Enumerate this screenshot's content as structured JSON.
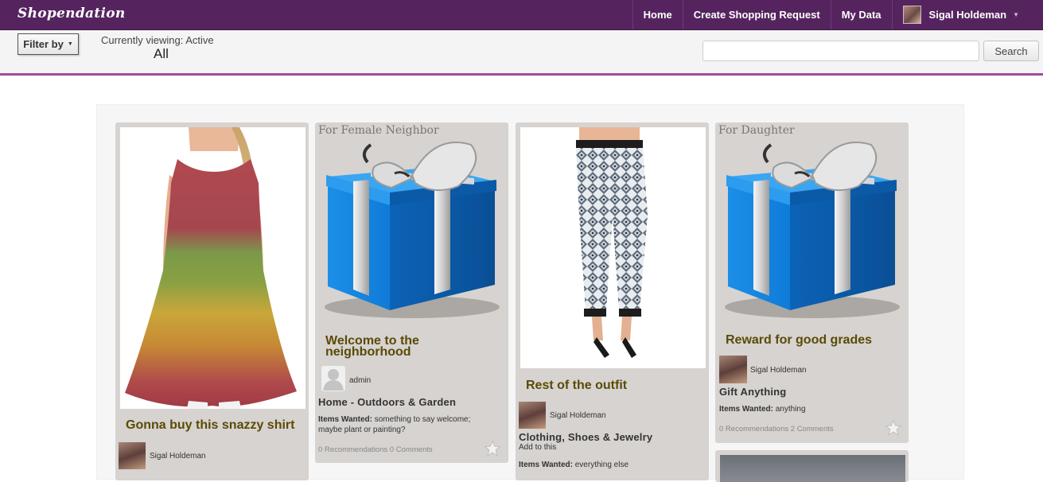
{
  "app": {
    "brand": "Shopendation"
  },
  "nav": {
    "home": "Home",
    "create": "Create Shopping Request",
    "mydata": "My Data",
    "user": "Sigal Holdeman"
  },
  "filter": {
    "button": "Filter by",
    "viewing_label": "Currently viewing: Active",
    "viewing_value": "All"
  },
  "search": {
    "placeholder": "",
    "button": "Search"
  },
  "cards": [
    {
      "title": "Gonna buy this snazzy shirt",
      "user": "Sigal Holdeman"
    },
    {
      "for": "For Female Neighbor",
      "title": "Welcome to the neighborhood",
      "user": "admin",
      "category": "Home - Outdoors & Garden",
      "wanted_label": "Items Wanted:",
      "wanted": "something to say welcome; maybe plant or painting?",
      "meta": "0 Recommendations 0 Comments"
    },
    {
      "title": "Rest of the outfit",
      "user": "Sigal Holdeman",
      "category": "Clothing, Shoes & Jewelry",
      "subnote": "Add to this",
      "wanted_label": "Items Wanted:",
      "wanted": "everything else"
    },
    {
      "for": "For Daughter",
      "title": "Reward for good grades",
      "user": "Sigal Holdeman",
      "category": "Gift Anything",
      "wanted_label": "Items Wanted:",
      "wanted": "anything",
      "meta": "0 Recommendations 2 Comments"
    }
  ],
  "colors": {
    "topbar": "#55245f",
    "accent": "#a3499c",
    "title": "#5b4a05"
  }
}
